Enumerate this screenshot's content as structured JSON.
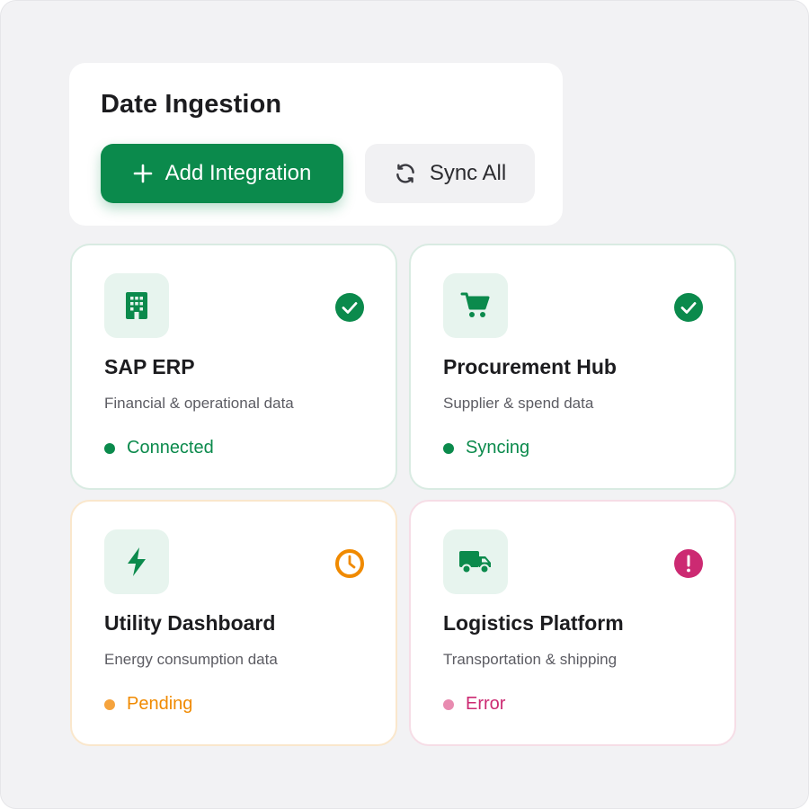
{
  "header": {
    "title": "Date Ingestion",
    "add_button_label": "Add Integration",
    "sync_button_label": "Sync All",
    "add_icon": "plus-icon",
    "sync_icon": "refresh-icon"
  },
  "colors": {
    "brand_green": "#0b8a4c",
    "pending_orange": "#f08a00",
    "error_pink": "#cc2a72",
    "tile_bg": "#e7f4ee"
  },
  "integrations": [
    {
      "name": "SAP ERP",
      "description": "Financial & operational data",
      "status": "Connected",
      "icon": "building-icon",
      "status_icon": "check-circle-icon"
    },
    {
      "name": "Procurement Hub",
      "description": "Supplier & spend data",
      "status": "Syncing",
      "icon": "cart-icon",
      "status_icon": "check-circle-icon"
    },
    {
      "name": "Utility Dashboard",
      "description": "Energy consumption data",
      "status": "Pending",
      "icon": "lightning-icon",
      "status_icon": "clock-icon"
    },
    {
      "name": "Logistics Platform",
      "description": "Transportation & shipping",
      "status": "Error",
      "icon": "truck-icon",
      "status_icon": "alert-circle-icon"
    }
  ]
}
